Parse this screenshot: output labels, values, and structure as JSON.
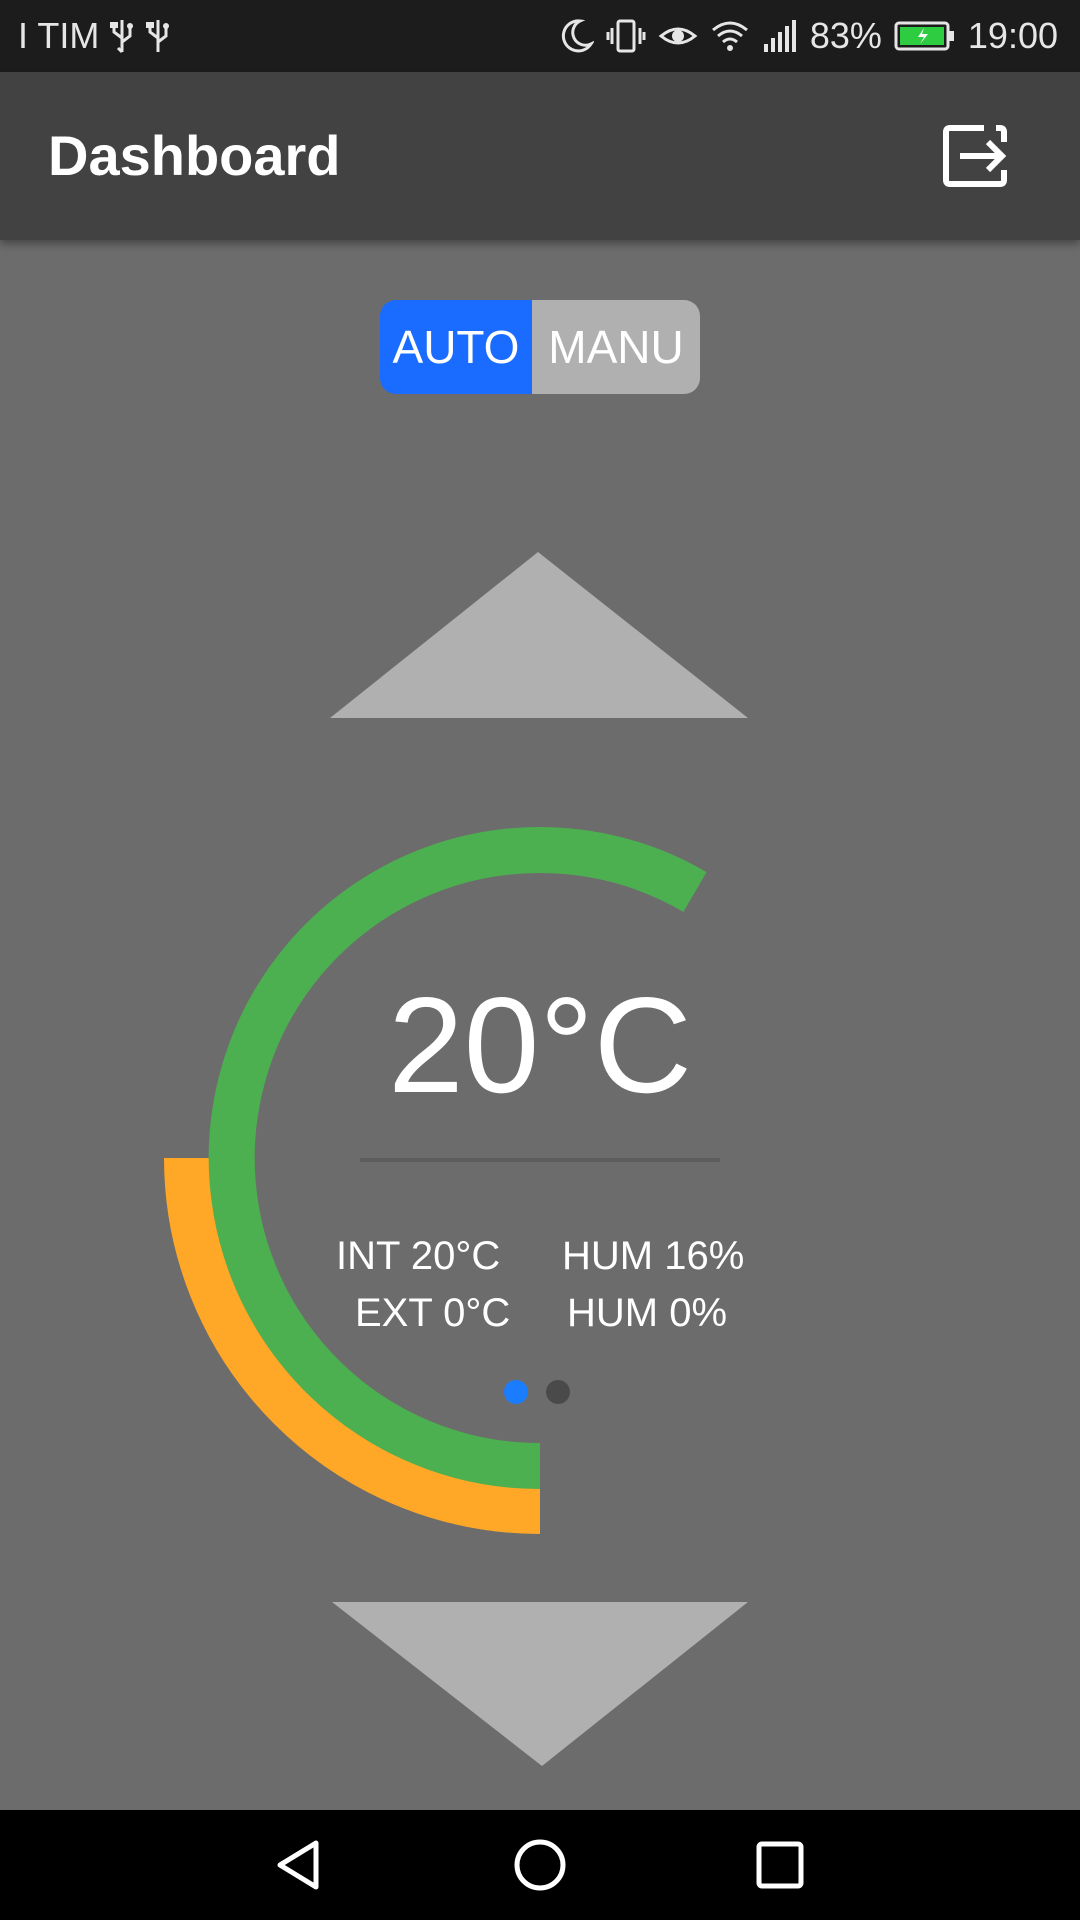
{
  "status_bar": {
    "carrier": "I TIM",
    "battery": "83%",
    "time": "19:00",
    "icons": [
      "usb-icon",
      "usb-icon",
      "moon-icon",
      "vibrate-icon",
      "eye-icon",
      "wifi-icon",
      "signal-icon",
      "battery-charging-icon"
    ]
  },
  "app_bar": {
    "title": "Dashboard",
    "action_icon": "logout-icon"
  },
  "mode_toggle": {
    "options": [
      "AUTO",
      "MANU"
    ],
    "selected": "AUTO",
    "colors": {
      "selected": "#1a6bff",
      "unselected": "#b0b0b0"
    }
  },
  "thermostat": {
    "temperature": "20°C",
    "int_label": "INT 20°C",
    "ext_label": "EXT 0°C",
    "hum_int_label": "HUM 16%",
    "hum_ext_label": "HUM 0%",
    "colors": {
      "inner_arc": "#4caf50",
      "outer_arc": "#ffa726"
    },
    "up_icon": "triangle-up-icon",
    "down_icon": "triangle-down-icon"
  },
  "pager": {
    "page_count": 2,
    "active_index": 0,
    "colors": {
      "active": "#1a7cff",
      "inactive": "#4a4a4a"
    }
  },
  "nav_bar": {
    "icons": [
      "back-icon",
      "home-icon",
      "recents-icon"
    ]
  }
}
